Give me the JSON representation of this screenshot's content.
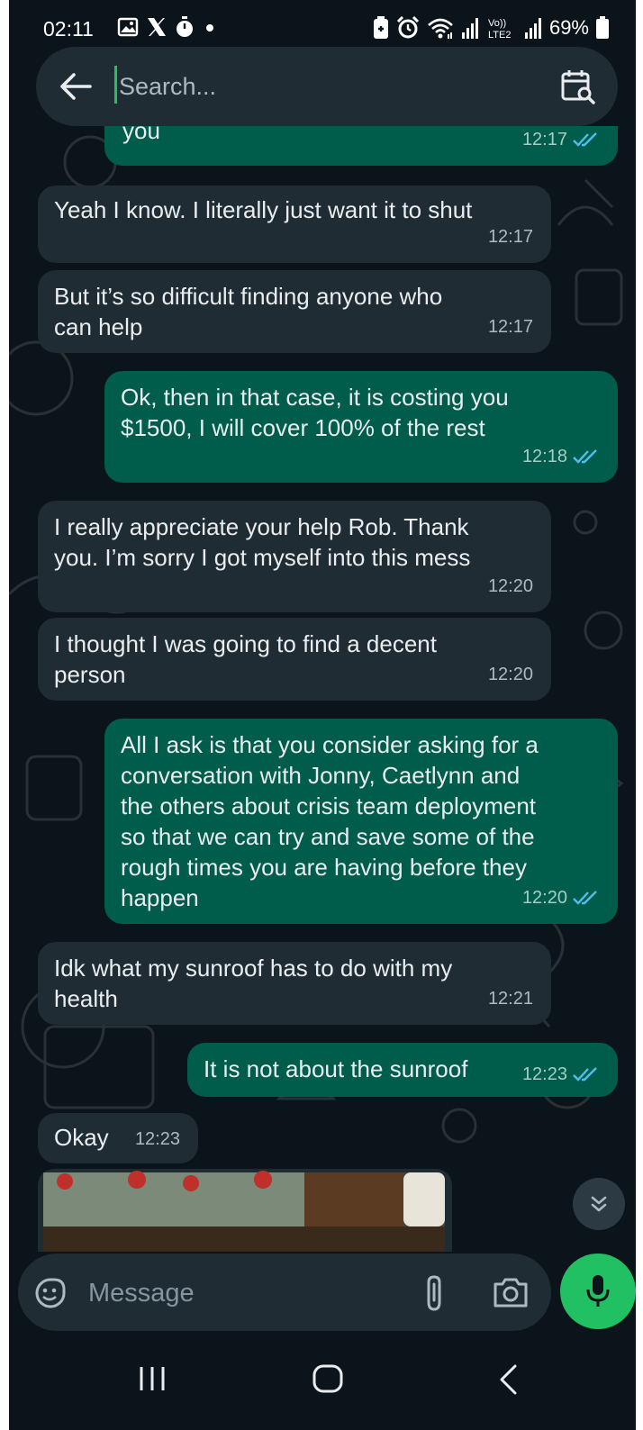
{
  "status_bar": {
    "time": "02:11",
    "battery": "69%",
    "left_icons": [
      "gallery-icon",
      "x-icon",
      "timer-icon",
      "dot-icon"
    ],
    "right_icons": [
      "battery-saver-icon",
      "alarm-icon",
      "wifi-icon",
      "signal-icon",
      "volte-icon",
      "signal-icon",
      "battery-icon"
    ],
    "network_label": "Vo)) LTE2"
  },
  "search": {
    "placeholder": "Search..."
  },
  "messages": [
    {
      "direction": "out",
      "text": "you",
      "time": "12:17",
      "ticks": "read"
    },
    {
      "direction": "in",
      "text": "Yeah I know. I literally just want it to shut",
      "time": "12:17"
    },
    {
      "direction": "in",
      "text": "But it’s so difficult finding anyone who\ncan help",
      "time": "12:17"
    },
    {
      "direction": "out",
      "text": "Ok, then in that case, it is costing you\n$1500, I will cover 100% of the rest",
      "time": "12:18",
      "ticks": "read"
    },
    {
      "direction": "in",
      "text": "I really appreciate your help Rob. Thank\nyou. I’m sorry I got myself into this mess",
      "time": "12:20"
    },
    {
      "direction": "in",
      "text": "I thought I was going to find a decent\nperson",
      "time": "12:20"
    },
    {
      "direction": "out",
      "text": "All I ask is that you consider asking for a\nconversation with Jonny, Caetlynn and\nthe others about crisis team deployment\nso that we can try and save some of the\nrough times you are having before they\nhappen",
      "time": "12:20",
      "ticks": "read"
    },
    {
      "direction": "in",
      "text": "Idk what my sunroof has to do with my\nhealth",
      "time": "12:21"
    },
    {
      "direction": "out",
      "text": "It is not about the sunroof",
      "time": "12:23",
      "ticks": "read"
    },
    {
      "direction": "in",
      "text": "Okay",
      "time": "12:23"
    }
  ],
  "composer": {
    "placeholder": "Message"
  },
  "colors": {
    "background": "#0b141a",
    "incoming": "#1f2c34",
    "outgoing": "#005c4b",
    "accent": "#21c063",
    "read_tick": "#53bdeb"
  }
}
